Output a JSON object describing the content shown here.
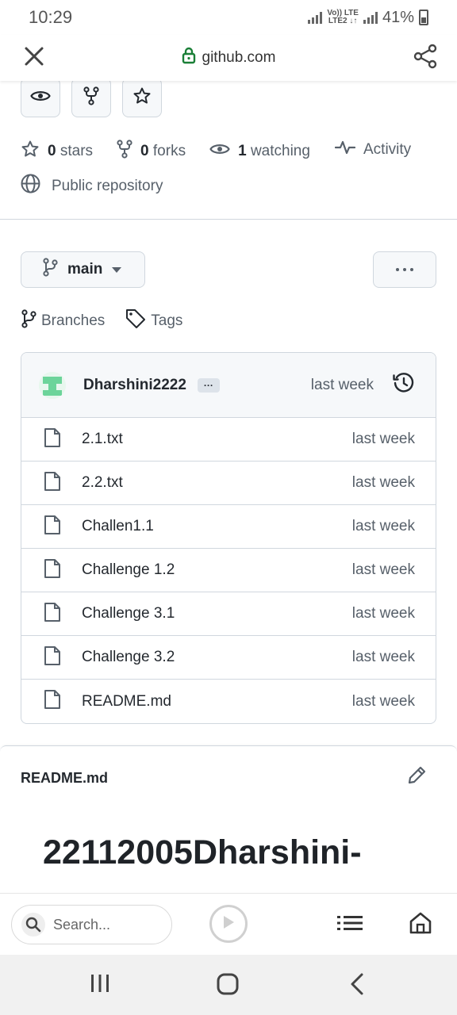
{
  "status_bar": {
    "time": "10:29",
    "network_label": "Vo)) LTE\nLTE2 ↓↑",
    "battery": "41%"
  },
  "browser": {
    "url": "github.com",
    "icons": {
      "close": "close-icon",
      "lock": "lock-icon",
      "share": "share-icon"
    }
  },
  "repo": {
    "stars": {
      "count": "0",
      "label": "stars"
    },
    "forks": {
      "count": "0",
      "label": "forks"
    },
    "watching": {
      "count": "1",
      "label": "watching"
    },
    "activity_label": "Activity",
    "visibility": "Public repository",
    "branch": "main",
    "branches_label": "Branches",
    "tags_label": "Tags"
  },
  "latest_commit": {
    "author": "Dharshini2222",
    "ellipsis": "···",
    "time": "last week"
  },
  "files": [
    {
      "name": "2.1.txt",
      "time": "last week"
    },
    {
      "name": "2.2.txt",
      "time": "last week"
    },
    {
      "name": "Challen1.1",
      "time": "last week"
    },
    {
      "name": "Challenge 1.2",
      "time": "last week"
    },
    {
      "name": "Challenge 3.1",
      "time": "last week"
    },
    {
      "name": "Challenge 3.2",
      "time": "last week"
    },
    {
      "name": "README.md",
      "time": "last week"
    }
  ],
  "readme": {
    "title": "README.md",
    "heading": "22112005Dharshini-"
  },
  "bottom_toolbar": {
    "search_placeholder": "Search..."
  },
  "colors": {
    "accent_green": "#1a7f37",
    "border": "#d0d7de",
    "muted": "#57606a"
  }
}
